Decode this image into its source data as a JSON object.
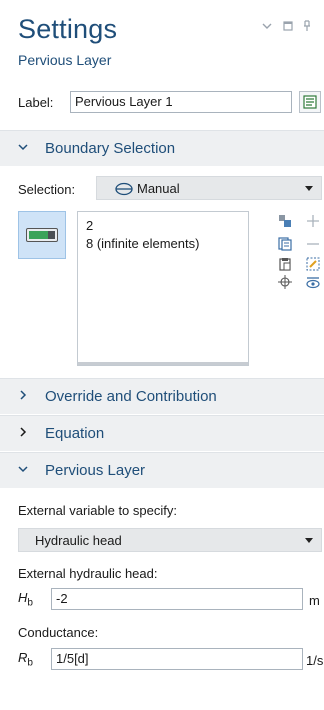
{
  "header": {
    "title": "Settings",
    "subtitle": "Pervious Layer"
  },
  "label_row": {
    "label": "Label:",
    "value": "Pervious Layer 1"
  },
  "sections": {
    "boundary_selection": "Boundary Selection",
    "override": "Override and Contribution",
    "equation": "Equation",
    "pervious_layer": "Pervious Layer"
  },
  "selection": {
    "label": "Selection:",
    "value": "Manual",
    "items": [
      "2",
      "8 (infinite elements)"
    ]
  },
  "pervious": {
    "external_variable_label": "External variable to specify:",
    "external_variable_value": "Hydraulic head",
    "head_label": "External hydraulic head:",
    "head_symbol": "H",
    "head_sub": "b",
    "head_value": "-2",
    "head_unit": "m",
    "conductance_label": "Conductance:",
    "cond_symbol": "R",
    "cond_sub": "b",
    "cond_value": "1/5[d]",
    "cond_unit": "1/s"
  },
  "colors": {
    "accent": "#1f4e79",
    "section_bg": "#eef0f2",
    "dropdown_bg": "#e6e8ea",
    "selection_toggle_bg": "#cfe3f7",
    "toggle_green": "#3aa35a"
  }
}
